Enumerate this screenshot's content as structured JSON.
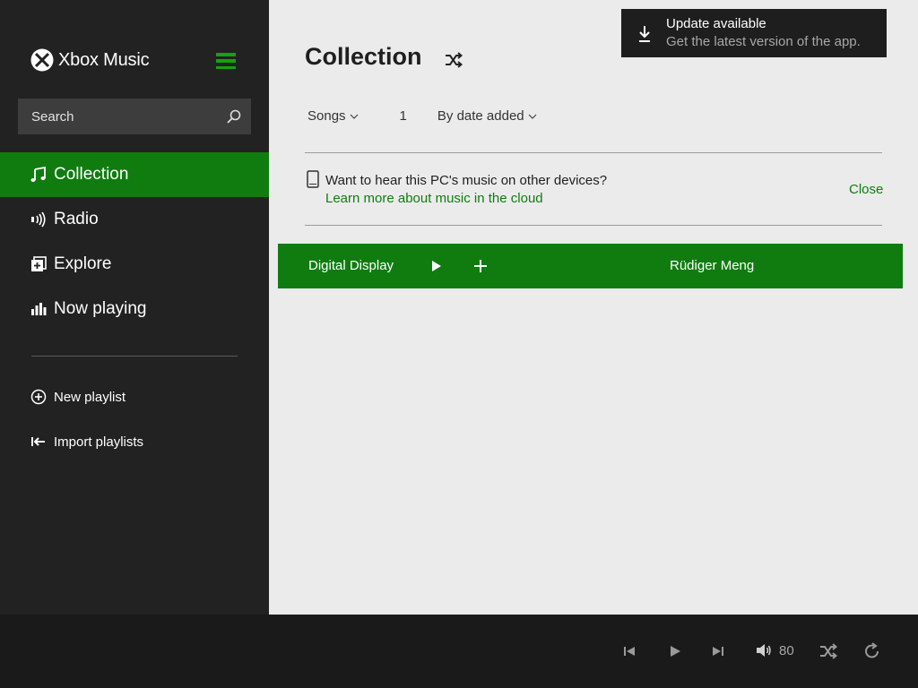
{
  "app": {
    "name": "Xbox Music"
  },
  "search": {
    "placeholder": "Search"
  },
  "nav": [
    {
      "label": "Collection",
      "icon": "music-note-icon",
      "active": true
    },
    {
      "label": "Radio",
      "icon": "radio-icon"
    },
    {
      "label": "Explore",
      "icon": "explore-icon"
    },
    {
      "label": "Now playing",
      "icon": "bars-icon"
    }
  ],
  "sub_actions": [
    {
      "label": "New playlist",
      "icon": "plus-circle-icon"
    },
    {
      "label": "Import playlists",
      "icon": "import-icon"
    }
  ],
  "main": {
    "title": "Collection",
    "filter_type": "Songs",
    "count": "1",
    "sort": "By date added"
  },
  "promo": {
    "text": "Want to hear this PC's music on other devices?",
    "link": "Learn more about music in the cloud",
    "close": "Close"
  },
  "songs": [
    {
      "title": "Digital Display",
      "artist": "Rüdiger Meng"
    }
  ],
  "toast": {
    "title": "Update available",
    "subtitle": "Get the latest version of the app."
  },
  "player": {
    "volume": "80"
  },
  "colors": {
    "accent": "#107c10",
    "accent_bright": "#16a20e",
    "sidebar": "#222222",
    "content": "#ebebeb",
    "player": "#1a1a1a"
  }
}
